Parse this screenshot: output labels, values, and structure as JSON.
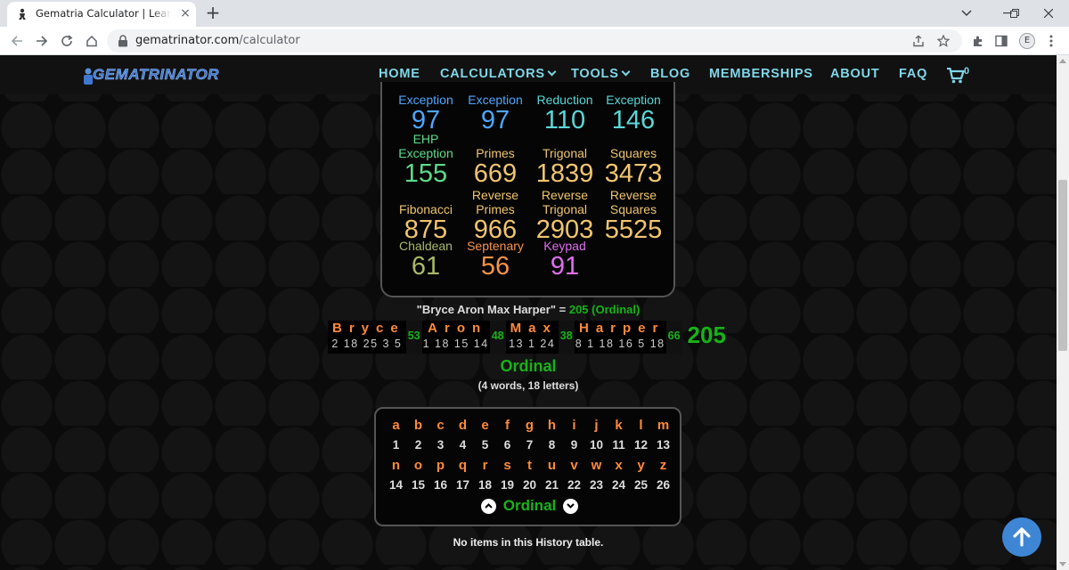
{
  "browser": {
    "tab_title": "Gematria Calculator | Learn Gematria",
    "tab_close": "×",
    "new_tab": "+",
    "url_host": "gematrinator.com",
    "url_path": "/calculator",
    "profile_initial": "E"
  },
  "site": {
    "logo_text": "GEMATRINATOR",
    "nav": {
      "home": "HOME",
      "calculators": "CALCULATORS",
      "tools": "TOOLS",
      "blog": "BLOG",
      "memberships": "MEMBERSHIPS",
      "about": "ABOUT",
      "faq": "FAQ"
    },
    "cart_count": "0"
  },
  "ciphers": [
    {
      "label": "Exception",
      "value": "97",
      "color": "#4da6ff"
    },
    {
      "label": "Exception",
      "value": "97",
      "color": "#4da6ff"
    },
    {
      "label": "Reduction",
      "value": "110",
      "color": "#5ad7d7"
    },
    {
      "label": "Exception",
      "value": "146",
      "color": "#5ad7d7"
    },
    {
      "label": "EHP Exception",
      "value": "155",
      "color": "#5ddb8a"
    },
    {
      "label": "Primes",
      "value": "669",
      "color": "#f0c56e"
    },
    {
      "label": "Trigonal",
      "value": "1839",
      "color": "#f0c56e"
    },
    {
      "label": "Squares",
      "value": "3473",
      "color": "#f0c56e"
    },
    {
      "label": "Fibonacci",
      "value": "875",
      "color": "#f0c56e"
    },
    {
      "label": "Reverse Primes",
      "value": "966",
      "color": "#f0c56e"
    },
    {
      "label": "Reverse Trigonal",
      "value": "2903",
      "color": "#f0c56e"
    },
    {
      "label": "Reverse Squares",
      "value": "5525",
      "color": "#f0c56e"
    },
    {
      "label": "Chaldean",
      "value": "61",
      "color": "#a8b86a"
    },
    {
      "label": "Septenary",
      "value": "56",
      "color": "#f5934a"
    },
    {
      "label": "Keypad",
      "value": "91",
      "color": "#e06ef0"
    }
  ],
  "result": {
    "phrase_quoted": "\"Bryce Aron Max Harper\" = ",
    "phrase_value": "205 (Ordinal)",
    "words": [
      {
        "letters": "Bryce",
        "values": "2 18 25 3 5",
        "sum": "53"
      },
      {
        "letters": "Aron",
        "values": "1 18 15 14",
        "sum": "48"
      },
      {
        "letters": "Max",
        "values": "13 1 24",
        "sum": "38"
      },
      {
        "letters": "Harper",
        "values": "8 1 18 16 5 18",
        "sum": "66"
      }
    ],
    "total": "205",
    "cipher_name": "Ordinal",
    "counts": "(4 words, 18 letters)"
  },
  "alphabet": {
    "row1_letters": [
      "a",
      "b",
      "c",
      "d",
      "e",
      "f",
      "g",
      "h",
      "i",
      "j",
      "k",
      "l",
      "m"
    ],
    "row1_values": [
      "1",
      "2",
      "3",
      "4",
      "5",
      "6",
      "7",
      "8",
      "9",
      "10",
      "11",
      "12",
      "13"
    ],
    "row2_letters": [
      "n",
      "o",
      "p",
      "q",
      "r",
      "s",
      "t",
      "u",
      "v",
      "w",
      "x",
      "y",
      "z"
    ],
    "row2_values": [
      "14",
      "15",
      "16",
      "17",
      "18",
      "19",
      "20",
      "21",
      "22",
      "23",
      "24",
      "25",
      "26"
    ],
    "cipher_name": "Ordinal"
  },
  "history_text": "No items in this History table."
}
